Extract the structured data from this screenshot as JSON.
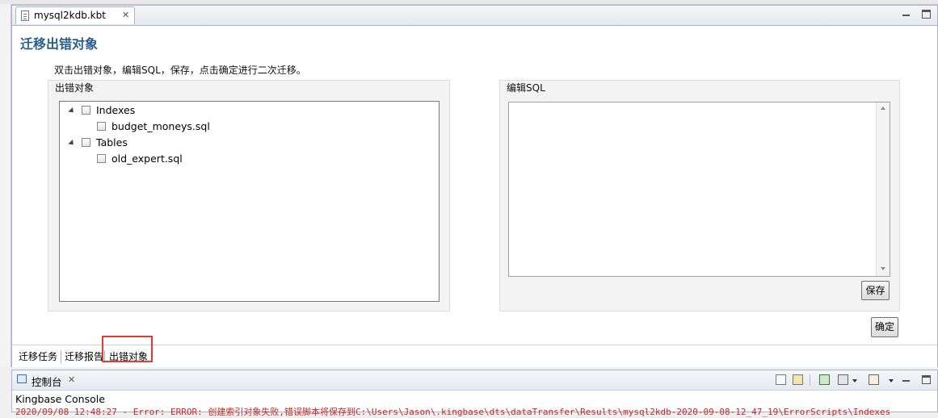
{
  "editor": {
    "tab_title": "mysql2kdb.kbt",
    "tab_close": "✕",
    "page_title": "迁移出错对象",
    "instruction": "双击出错对象，编辑SQL，保存，点击确定进行二次迁移。",
    "error_objects_label": "出错对象",
    "tree": [
      {
        "label": "Indexes",
        "children": [
          "budget_moneys.sql"
        ]
      },
      {
        "label": "Tables",
        "children": [
          "old_expert.sql"
        ]
      }
    ],
    "sql_label": "编辑SQL",
    "save_button": "保存",
    "confirm_button": "确定",
    "bottom_tabs": [
      "迁移任务",
      "迁移报告",
      "出错对象"
    ],
    "active_tab": "出错对象"
  },
  "console": {
    "tab_title": "控制台",
    "tab_close": "✕",
    "title": "Kingbase Console",
    "log_line": "2020/09/08 12:48:27 - Error: ERROR: 创建索引对象失败,错误脚本将保存到C:\\Users\\Jason\\.kingbase\\dts\\dataTransfer\\Results\\mysql2kdb-2020-09-08-12_47_19\\ErrorScripts\\Indexes"
  },
  "colors": {
    "title_blue": "#2a5d8f",
    "highlight_red": "#e53935",
    "log_red": "#c62828"
  }
}
